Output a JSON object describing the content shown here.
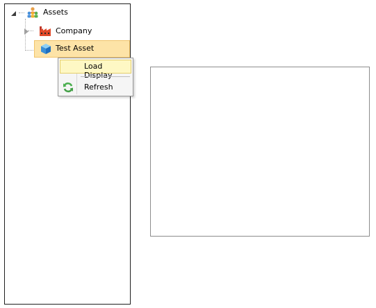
{
  "tree": {
    "root": {
      "label": "Assets",
      "icon": "assets-people-icon",
      "expanded": true
    },
    "children": [
      {
        "label": "Company",
        "icon": "factory-icon",
        "expanded": false
      },
      {
        "label": "Test Asset",
        "icon": "cube-icon",
        "selected": true
      }
    ]
  },
  "context_menu": {
    "items": [
      {
        "label": "Load Display",
        "highlighted": true
      },
      {
        "label": "Refresh",
        "icon": "refresh-icon"
      }
    ]
  },
  "colors": {
    "selection_fill": "#fde3a7",
    "menu_highlight": "#fef8c4",
    "menu_background": "#f5f5f5"
  }
}
